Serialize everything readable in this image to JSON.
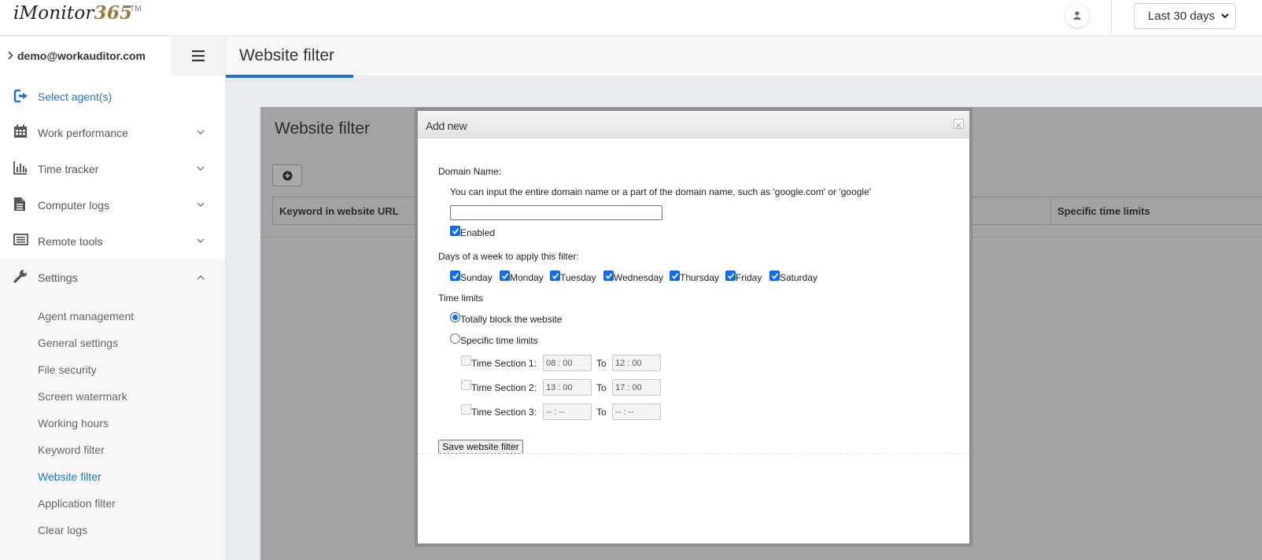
{
  "app": {
    "logo_text": "iMonitor",
    "logo_num": "365",
    "logo_tm": "TM",
    "period_select": "Last 30 days"
  },
  "sidebar": {
    "account": "demo@workauditor.com",
    "items": [
      {
        "label": "Select agent(s)",
        "icon": "sign-in-icon"
      },
      {
        "label": "Work performance",
        "icon": "calendar-icon"
      },
      {
        "label": "Time tracker",
        "icon": "bar-chart-icon"
      },
      {
        "label": "Computer logs",
        "icon": "file-icon"
      },
      {
        "label": "Remote tools",
        "icon": "keyboard-icon"
      },
      {
        "label": "Settings",
        "icon": "wrench-icon"
      }
    ],
    "settings_submenu": [
      "Agent management",
      "General settings",
      "File security",
      "Screen watermark",
      "Working hours",
      "Keyword filter",
      "Website filter",
      "Application filter",
      "Clear logs"
    ]
  },
  "main": {
    "page_title": "Website filter",
    "card_title": "Website filter",
    "columns": [
      "Keyword in website URL",
      "Specific time limits"
    ]
  },
  "modal": {
    "title": "Add new",
    "domain_label": "Domain Name:",
    "domain_hint": "You can input the entire domain name or a part of the domain name, such as 'google.com' or 'google'",
    "domain_value": "",
    "enabled_label": "Enabled",
    "days_label": "Days of a week to apply this filter:",
    "days": [
      "Sunday",
      "Monday",
      "Tuesday",
      "Wednesday",
      "Thursday",
      "Friday",
      "Saturday"
    ],
    "time_limits_label": "Time limits",
    "option_block": "Totally block the website",
    "option_specific": "Specific time limits",
    "sections": [
      {
        "label": "Time Section 1:",
        "from": "08 : 00",
        "to_label": "To",
        "to": "12 : 00"
      },
      {
        "label": "Time Section 2:",
        "from": "13 : 00",
        "to_label": "To",
        "to": "17 : 00"
      },
      {
        "label": "Time Section 3:",
        "from": "-- : --",
        "to_label": "To",
        "to": "-- : --"
      }
    ],
    "save_button": "Save website filter"
  },
  "colors": {
    "accent": "#1c74c4",
    "logo_gold": "#9b7a3b",
    "overlay": "#a3a3a3"
  }
}
